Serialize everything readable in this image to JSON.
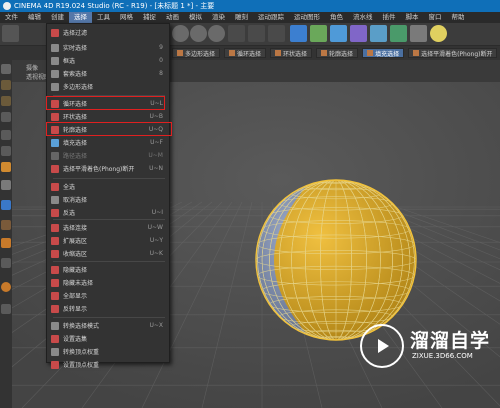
{
  "window": {
    "title": "CINEMA 4D R19.024 Studio (RC - R19) - [未标题 1 *] - 主要"
  },
  "menubar": {
    "items": [
      {
        "label": "文件",
        "active": false
      },
      {
        "label": "编辑",
        "active": false
      },
      {
        "label": "创建",
        "active": false
      },
      {
        "label": "选择",
        "active": true
      },
      {
        "label": "工具",
        "active": false
      },
      {
        "label": "网格",
        "active": false
      },
      {
        "label": "捕捉",
        "active": false
      },
      {
        "label": "动画",
        "active": false
      },
      {
        "label": "模拟",
        "active": false
      },
      {
        "label": "渲染",
        "active": false
      },
      {
        "label": "雕刻",
        "active": false
      },
      {
        "label": "运动跟踪",
        "active": false
      },
      {
        "label": "运动图形",
        "active": false
      },
      {
        "label": "角色",
        "active": false
      },
      {
        "label": "流水线",
        "active": false
      },
      {
        "label": "插件",
        "active": false
      },
      {
        "label": "脚本",
        "active": false
      },
      {
        "label": "窗口",
        "active": false
      },
      {
        "label": "帮助",
        "active": false
      }
    ]
  },
  "modebar": {
    "items": [
      {
        "label": "多边形选择",
        "active": false
      },
      {
        "label": "循环选择",
        "active": false
      },
      {
        "label": "环状选择",
        "active": false
      },
      {
        "label": "轮廓选择",
        "active": false
      },
      {
        "label": "填充选择",
        "active": true
      },
      {
        "label": "选择平滑着色(Phong)断开",
        "active": false
      }
    ]
  },
  "subhead": {
    "tab1": "摄像",
    "tab2": "透视视图"
  },
  "menu": {
    "items": [
      {
        "label": "选择过滤",
        "shortcut": "",
        "arrow": true
      },
      {
        "label": "实时选择",
        "shortcut": "9"
      },
      {
        "label": "框选",
        "shortcut": "0"
      },
      {
        "label": "套索选择",
        "shortcut": "8"
      },
      {
        "label": "多边形选择",
        "shortcut": ""
      },
      {
        "label": "循环选择",
        "shortcut": "U~L"
      },
      {
        "label": "环状选择",
        "shortcut": "U~B"
      },
      {
        "label": "轮廓选择",
        "shortcut": "U~Q"
      },
      {
        "label": "填充选择",
        "shortcut": "U~F"
      },
      {
        "label": "路径选择",
        "shortcut": "U~M",
        "disabled": true
      },
      {
        "label": "选择平滑着色(Phong)断开",
        "shortcut": "U~N"
      },
      {
        "label": "全选",
        "shortcut": ""
      },
      {
        "label": "取消选择",
        "shortcut": ""
      },
      {
        "label": "反选",
        "shortcut": "U~I"
      },
      {
        "label": "选择连接",
        "shortcut": "U~W"
      },
      {
        "label": "扩展选区",
        "shortcut": "U~Y"
      },
      {
        "label": "收缩选区",
        "shortcut": "U~K"
      },
      {
        "label": "隐藏选择",
        "shortcut": ""
      },
      {
        "label": "隐藏未选择",
        "shortcut": ""
      },
      {
        "label": "全部显示",
        "shortcut": ""
      },
      {
        "label": "反转显示",
        "shortcut": ""
      },
      {
        "label": "转换选择模式",
        "shortcut": "U~X"
      },
      {
        "label": "设置选集",
        "shortcut": ""
      },
      {
        "label": "转换顶点权重",
        "shortcut": ""
      },
      {
        "label": "设置顶点权重",
        "shortcut": ""
      }
    ]
  },
  "watermark": {
    "title": "溜溜自学",
    "url": "ZIXUE.3D66.COM"
  },
  "colors": {
    "titlebar": "#0f6fb8",
    "menu_active": "#5577a8",
    "highlight_box": "#e02020",
    "sphere_selected": "#d8a51c",
    "sphere_unselected": "#7e8fb0"
  }
}
